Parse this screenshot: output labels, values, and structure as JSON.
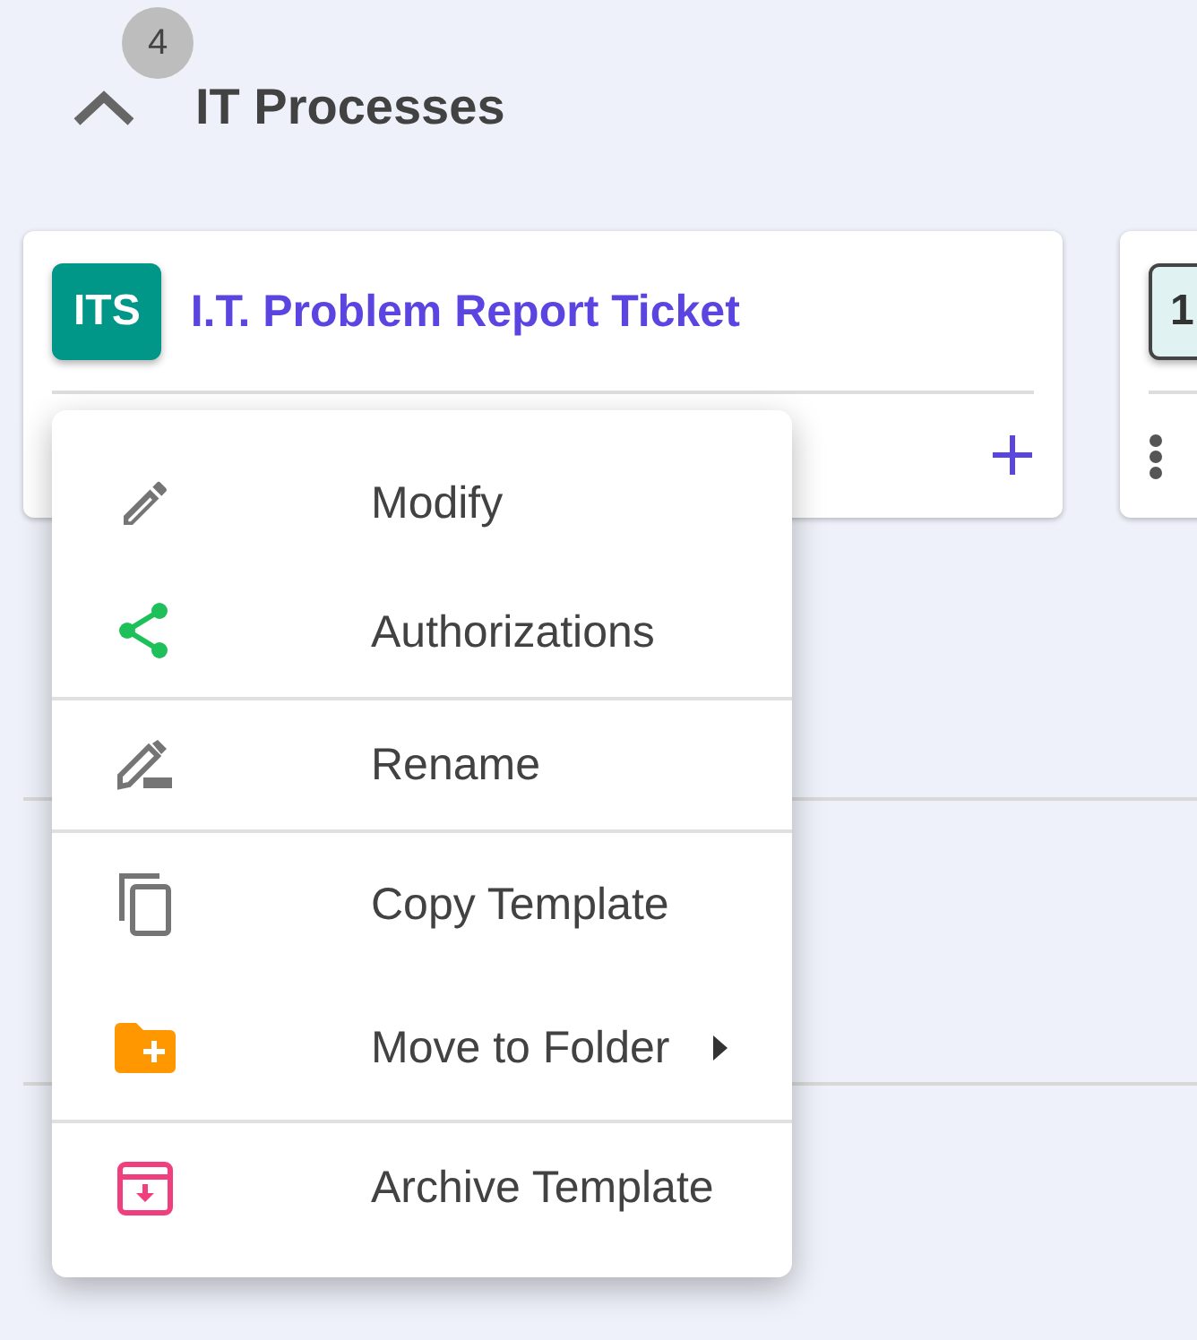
{
  "section": {
    "title": "IT Processes",
    "count": "4",
    "expanded": true
  },
  "cards": [
    {
      "badge": "ITS",
      "title": "I.T. Problem Report Ticket"
    },
    {
      "badge": "1"
    }
  ],
  "menu": {
    "sections": [
      [
        {
          "label": "Modify",
          "submenu": false
        },
        {
          "label": "Authorizations",
          "submenu": false
        }
      ],
      [
        {
          "label": "Rename",
          "submenu": false
        }
      ],
      [
        {
          "label": "Copy Template",
          "submenu": false
        },
        {
          "label": "Move to Folder",
          "submenu": true
        }
      ],
      [
        {
          "label": "Archive Template",
          "submenu": false
        }
      ]
    ]
  }
}
